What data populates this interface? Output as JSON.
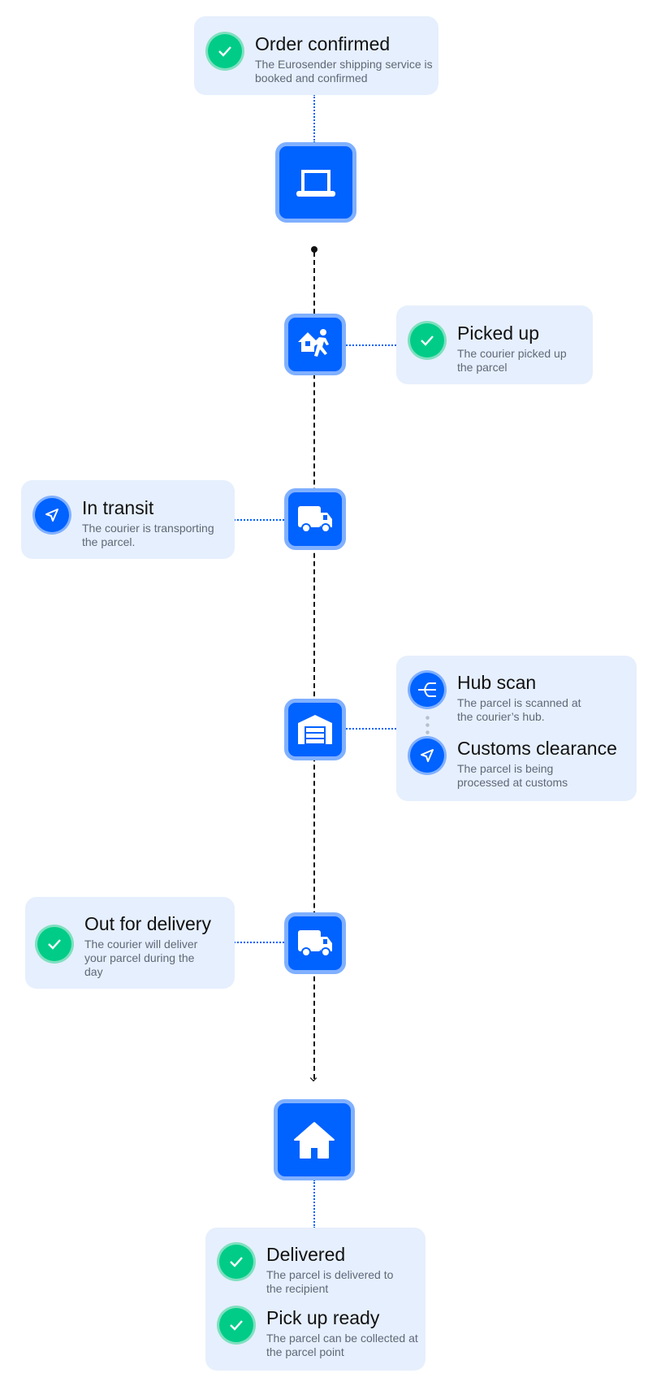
{
  "colors": {
    "accent": "#0062ff",
    "success": "#00cc88",
    "card": "#e6effd"
  },
  "steps": {
    "order_confirmed": {
      "title": "Order confirmed",
      "desc": "The Eurosender shipping service is booked and confirmed",
      "icon": "check-icon"
    },
    "picked_up": {
      "title": "Picked up",
      "desc": "The courier picked up the parcel",
      "icon": "check-icon"
    },
    "in_transit": {
      "title": "In transit",
      "desc": "The courier is transporting the parcel.",
      "icon": "navigation-arrow-icon"
    },
    "hub_scan": {
      "title": "Hub scan",
      "desc": "The parcel is scanned at the courier’s hub.",
      "icon": "hub-split-icon"
    },
    "customs": {
      "title": "Customs clearance",
      "desc": "The parcel is being processed at customs",
      "icon": "navigation-arrow-icon"
    },
    "out_for_delivery": {
      "title": "Out for delivery",
      "desc": "The courier will deliver your parcel during the day",
      "icon": "check-icon"
    },
    "delivered": {
      "title": "Delivered",
      "desc": "The parcel is delivered to the recipient",
      "icon": "check-icon"
    },
    "pickup_ready": {
      "title": "Pick up ready",
      "desc": "The parcel can be collected at the parcel point",
      "icon": "check-icon"
    }
  },
  "stages": [
    "laptop-icon",
    "house-courier-icon",
    "truck-icon",
    "warehouse-icon",
    "truck-icon",
    "home-icon"
  ]
}
